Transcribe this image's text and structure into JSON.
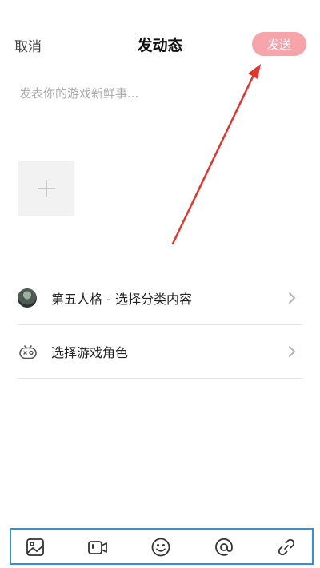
{
  "header": {
    "cancel_label": "取消",
    "title": "发动态",
    "send_label": "发送"
  },
  "composer": {
    "placeholder": "发表你的游戏新鲜事..."
  },
  "options": {
    "category_label": "第五人格 - 选择分类内容",
    "role_label": "选择游戏角色"
  },
  "toolbar": {
    "icons": [
      "image-icon",
      "video-icon",
      "emoji-icon",
      "mention-icon",
      "link-icon"
    ]
  },
  "colors": {
    "send_button": "#f7a3aa",
    "annotation_arrow": "#e8322b",
    "toolbar_highlight": "#2f8fe0"
  }
}
